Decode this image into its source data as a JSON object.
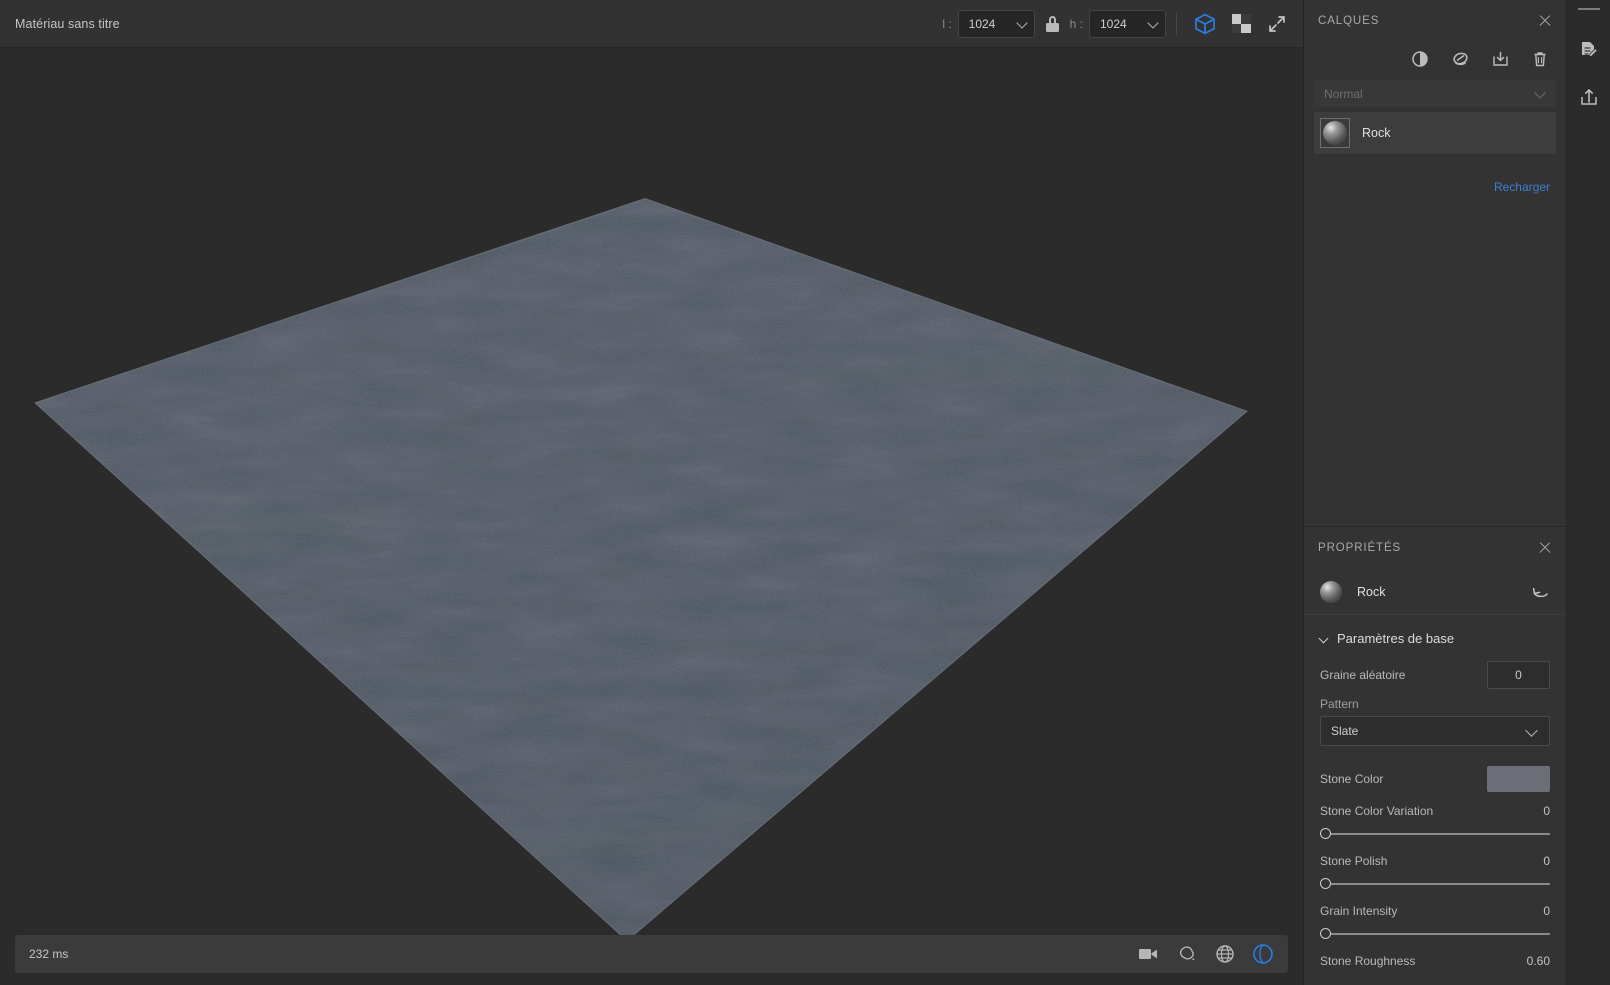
{
  "topbar": {
    "document_title": "Matériau sans titre",
    "width_label": "l :",
    "width_value": "1024",
    "height_label": "h :",
    "height_value": "1024",
    "lock_icon": "lock-icon",
    "view_3d_icon": "cube-3d-icon",
    "view_2d_icon": "checkerboard-icon",
    "fullscreen_icon": "expand-diagonal-icon",
    "accent_color": "#2a7de1"
  },
  "viewport": {
    "material_base_color": "#565e6a",
    "background_color": "#2b2b2b"
  },
  "statusbar": {
    "render_time": "232 ms",
    "icons": [
      "camera-icon",
      "environment-icon",
      "globe-grid-icon",
      "rotate-orbit-icon"
    ],
    "active_icon_color": "#2a7de1"
  },
  "layers_panel": {
    "title": "CALQUES",
    "close_icon": "close-icon",
    "tools": [
      "adjustment-half-circle-icon",
      "filter-leaf-icon",
      "import-icon",
      "trash-icon"
    ],
    "blend_mode": "Normal",
    "reload_link": "Recharger",
    "reload_link_color": "#3f7fd0",
    "layers": [
      {
        "name": "Rock",
        "thumbnail": "sphere-thumbnail",
        "selected": true
      }
    ]
  },
  "properties_panel": {
    "title": "PROPRIÉTÉS",
    "close_icon": "close-icon",
    "object_name": "Rock",
    "object_thumbnail": "sphere-thumbnail",
    "reset_icon": "reset-arrow-icon",
    "section": {
      "title": "Paramètres de base",
      "expanded": true
    },
    "fields": {
      "random_seed": {
        "label": "Graine aléatoire",
        "value": "0"
      },
      "pattern": {
        "label": "Pattern",
        "value": "Slate"
      },
      "stone_color": {
        "label": "Stone Color",
        "value": "#6b6e76"
      },
      "stone_color_variation": {
        "label": "Stone Color Variation",
        "value": "0",
        "percent": 0
      },
      "stone_polish": {
        "label": "Stone Polish",
        "value": "0",
        "percent": 0
      },
      "grain_intensity": {
        "label": "Grain Intensity",
        "value": "0",
        "percent": 0
      },
      "stone_roughness": {
        "label": "Stone Roughness",
        "value": "0.60",
        "percent": 60
      }
    }
  },
  "right_rail": {
    "buttons": [
      "edit-document-icon",
      "export-upload-icon"
    ]
  }
}
